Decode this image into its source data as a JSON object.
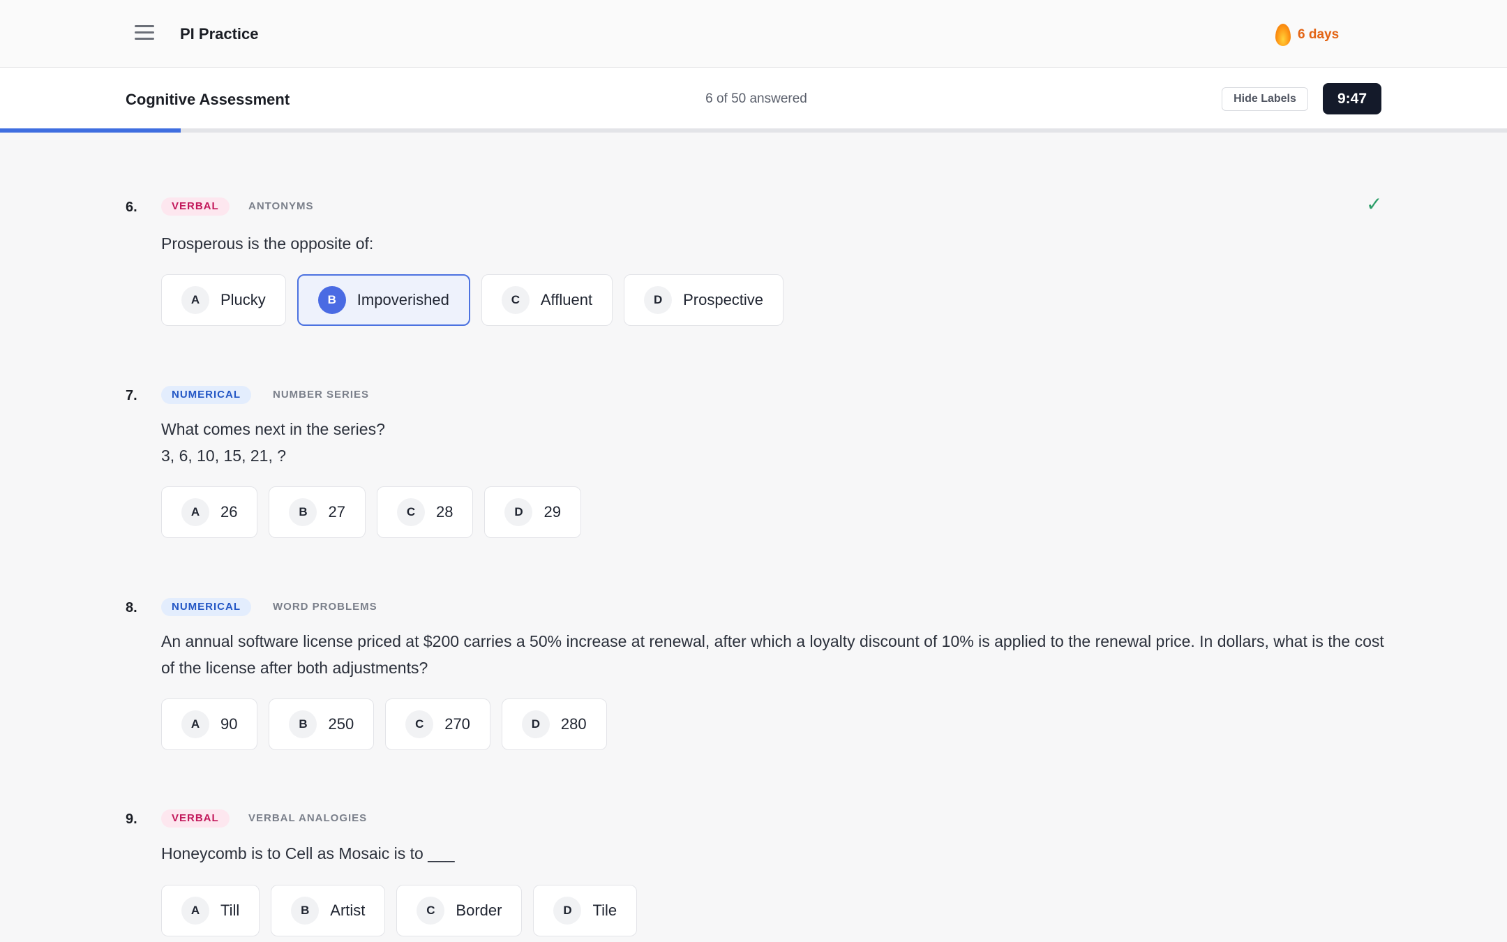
{
  "header": {
    "app_title": "PI Practice",
    "streak": "6 days"
  },
  "assessment": {
    "title": "Cognitive Assessment",
    "progress_text": "6 of 50 answered",
    "progress_fraction": 0.12,
    "hide_labels": "Hide Labels",
    "timer": "9:47"
  },
  "questions": [
    {
      "number": "6.",
      "category": "VERBAL",
      "subcategory": "ANTONYMS",
      "answered_mark": "✓",
      "text": "Prosperous is the opposite of:",
      "options": [
        {
          "letter": "A",
          "label": "Plucky"
        },
        {
          "letter": "B",
          "label": "Impoverished",
          "selected": true
        },
        {
          "letter": "C",
          "label": "Affluent"
        },
        {
          "letter": "D",
          "label": "Prospective"
        }
      ]
    },
    {
      "number": "7.",
      "category": "NUMERICAL",
      "subcategory": "NUMBER SERIES",
      "text": "What comes next in the series?",
      "text_line2": "3, 6, 10, 15, 21, ?",
      "options": [
        {
          "letter": "A",
          "label": "26"
        },
        {
          "letter": "B",
          "label": "27"
        },
        {
          "letter": "C",
          "label": "28"
        },
        {
          "letter": "D",
          "label": "29"
        }
      ]
    },
    {
      "number": "8.",
      "category": "NUMERICAL",
      "subcategory": "WORD PROBLEMS",
      "text": "An annual software license priced at $200 carries a 50% increase at renewal, after which a loyalty discount of 10% is applied to the renewal price. In dollars, what is the cost of the license after both adjustments?",
      "options": [
        {
          "letter": "A",
          "label": "90"
        },
        {
          "letter": "B",
          "label": "250"
        },
        {
          "letter": "C",
          "label": "270"
        },
        {
          "letter": "D",
          "label": "280"
        }
      ]
    },
    {
      "number": "9.",
      "category": "VERBAL",
      "subcategory": "VERBAL ANALOGIES",
      "text": "Honeycomb is to Cell as Mosaic is to ___",
      "options": [
        {
          "letter": "A",
          "label": "Till"
        },
        {
          "letter": "B",
          "label": "Artist"
        },
        {
          "letter": "C",
          "label": "Border"
        },
        {
          "letter": "D",
          "label": "Tile"
        }
      ]
    }
  ],
  "colors": {
    "accent": "#4a6be3",
    "verbal": "#c2185b",
    "numerical": "#2457c5",
    "streak": "#e36414",
    "check": "#2e9e6a"
  }
}
